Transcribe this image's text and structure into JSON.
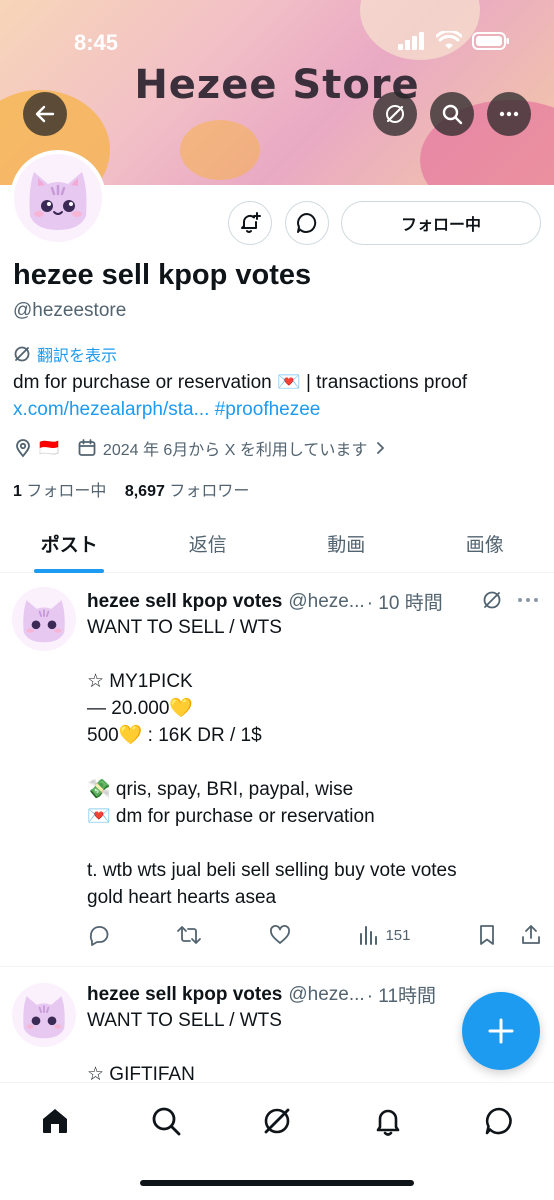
{
  "status_bar": {
    "time": "8:45"
  },
  "banner": {
    "title": "Hezee Store"
  },
  "profile": {
    "display_name": "hezee sell kpop votes",
    "handle": "@hezeestore",
    "follow_button": "フォロー中",
    "translate_label": "翻訳を表示",
    "bio_line1": "dm for purchase or reservation 💌 | transactions proof",
    "bio_link": "x.com/hezealarph/sta...",
    "bio_hashtag": "#proofhezee",
    "location_flag": "🇮🇩",
    "joined": "2024 年 6月から X を利用しています",
    "following_count": "1",
    "following_label": "フォロー中",
    "followers_count": "8,697",
    "followers_label": "フォロワー"
  },
  "tabs": [
    {
      "label": "ポスト",
      "active": true
    },
    {
      "label": "返信",
      "active": false
    },
    {
      "label": "動画",
      "active": false
    },
    {
      "label": "画像",
      "active": false
    }
  ],
  "posts": [
    {
      "name": "hezee sell kpop votes",
      "handle": "@heze...",
      "time": "· 10 時間",
      "body": "WANT TO SELL / WTS\n\n☆ MY1PICK\n— 20.000💛\n500💛 : 16K DR / 1$\n\n💸 qris, spay, BRI, paypal, wise\n💌 dm for purchase or reservation\n\nt. wtb wts jual beli sell selling buy vote votes\ngold heart hearts asea",
      "views": "151"
    },
    {
      "name": "hezee sell kpop votes",
      "handle": "@heze...",
      "time": "· 11時間",
      "body": "WANT TO SELL / WTS\n\n☆ GIFTIFAN"
    }
  ],
  "colors": {
    "accent": "#1d9bf0",
    "text": "#0f1419",
    "muted": "#536471"
  }
}
